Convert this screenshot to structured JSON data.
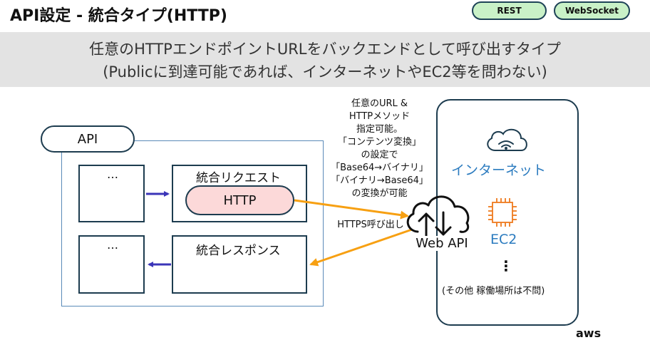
{
  "header": {
    "title": "API設定 - 統合タイプ(HTTP)",
    "badges": {
      "rest": "REST",
      "websocket": "WebSocket"
    }
  },
  "subtitle": {
    "line1": "任意のHTTPエンドポイントURLをバックエンドとして呼び出すタイプ",
    "line2": "(Publicに到達可能であれば、インターネットやEC2等を問わない)"
  },
  "api": {
    "label": "API",
    "method_placeholder": "…",
    "response_placeholder": "…",
    "integration_request": "統合リクエスト",
    "http_label": "HTTP",
    "integration_response": "統合レスポンス"
  },
  "annotations": {
    "any_url": {
      "lines": [
        "任意のURL &",
        "HTTPメソッド",
        "指定可能。",
        "「コンテンツ変換」",
        "の設定で",
        "「Base64→バイナリ」",
        "「バイナリ→Base64」",
        "の変換が可能"
      ]
    },
    "https_call": "HTTPS呼び出し"
  },
  "backend": {
    "web_api": "Web API",
    "internet": "インターネット",
    "ec2": "EC2",
    "ellipsis": "⋮",
    "other": "(その他 稼働場所は不問)"
  },
  "footer": {
    "logo_fragment": "aws"
  },
  "colors": {
    "pill_fill": "#c9f1c7",
    "box_border": "#1d3c4f",
    "frame_border": "#5a8ab8",
    "http_fill": "#fcd9d9",
    "arrow_orange": "#f7a012",
    "arrow_blue": "#3b35b8",
    "accent_blue": "#2b7bbf",
    "ec2_orange": "#ee7a1e"
  }
}
